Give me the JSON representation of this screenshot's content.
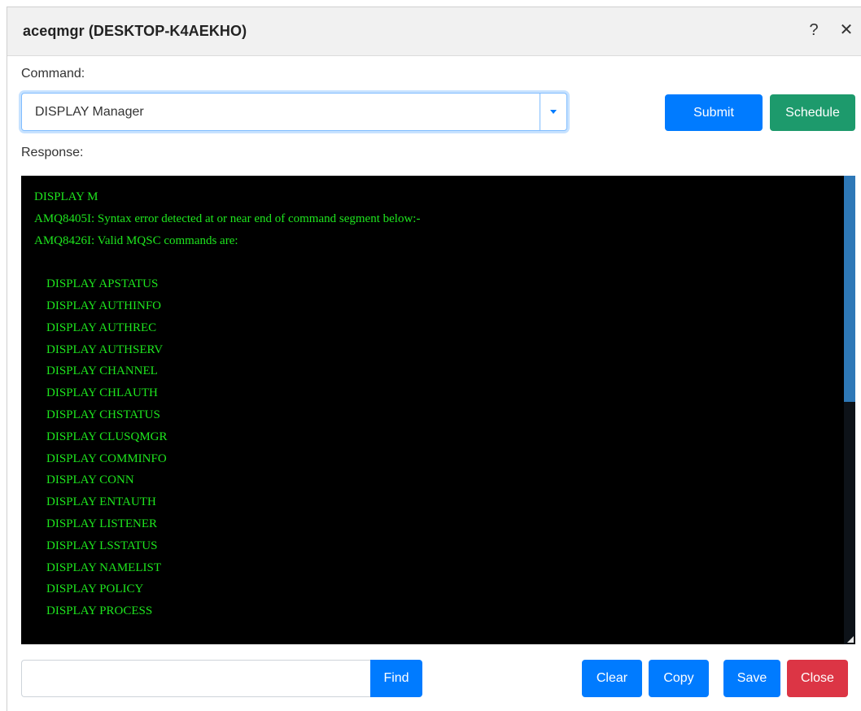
{
  "window": {
    "title": "aceqmgr (DESKTOP-K4AEKHO)",
    "help_glyph": "?",
    "close_glyph": "✕"
  },
  "command": {
    "label": "Command:",
    "value": "DISPLAY Manager"
  },
  "buttons": {
    "submit": "Submit",
    "schedule": "Schedule",
    "find": "Find",
    "clear": "Clear",
    "copy": "Copy",
    "save": "Save",
    "close": "Close"
  },
  "response": {
    "label": "Response:",
    "lines": [
      "DISPLAY M",
      "AMQ8405I: Syntax error detected at or near end of command segment below:-",
      "AMQ8426I: Valid MQSC commands are:",
      "",
      "    DISPLAY APSTATUS",
      "    DISPLAY AUTHINFO",
      "    DISPLAY AUTHREC",
      "    DISPLAY AUTHSERV",
      "    DISPLAY CHANNEL",
      "    DISPLAY CHLAUTH",
      "    DISPLAY CHSTATUS",
      "    DISPLAY CLUSQMGR",
      "    DISPLAY COMMINFO",
      "    DISPLAY CONN",
      "    DISPLAY ENTAUTH",
      "    DISPLAY LISTENER",
      "    DISPLAY LSSTATUS",
      "    DISPLAY NAMELIST",
      "    DISPLAY POLICY",
      "    DISPLAY PROCESS"
    ]
  },
  "find": {
    "value": "",
    "placeholder": ""
  },
  "colors": {
    "primary": "#007bff",
    "success": "#1d9a6c",
    "danger": "#dc3545",
    "console_bg": "#000000",
    "console_text": "#1ee61e",
    "scroll_thumb": "#2e78b7"
  },
  "icons": {
    "help": "help-icon",
    "close": "close-icon",
    "dropdown": "chevron-down-icon",
    "resize": "resize-grip-icon"
  }
}
